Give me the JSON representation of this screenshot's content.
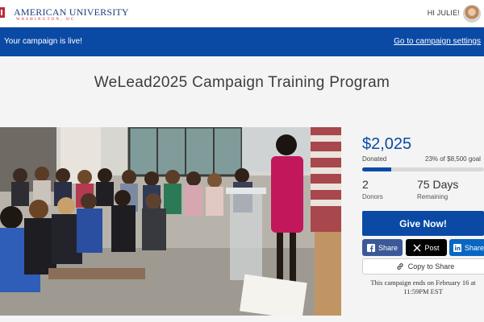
{
  "header": {
    "logo_text": "AMERICAN UNIVERSITY",
    "logo_sub": "WASHINGTON, DC",
    "greeting": "HI JULIE!"
  },
  "banner": {
    "message": "Your campaign is live!",
    "link": "Go to campaign settings"
  },
  "title": "WeLead2025 Campaign Training Program",
  "campaign": {
    "amount": "$2,025",
    "donated_label": "Donated",
    "percent_text": "23% of $8,500 goal",
    "progress_fraction": 0.238,
    "donors_count": "2",
    "donors_label": "Donors",
    "days_value": "75 Days",
    "days_label": "Remaining",
    "give_label": "Give Now!",
    "share_facebook": "Share",
    "share_x": "Post",
    "share_linkedin": "Share",
    "copy_label": "Copy to Share",
    "ends_text": "This campaign ends on February 16 at 11:59PM EST"
  },
  "colors": {
    "primary": "#0a4aa5",
    "facebook": "#3b5998",
    "x": "#000000",
    "linkedin": "#0a66c2"
  },
  "icons": [
    "university-shield-icon",
    "avatar",
    "facebook-icon",
    "x-icon",
    "linkedin-icon",
    "link-icon"
  ]
}
